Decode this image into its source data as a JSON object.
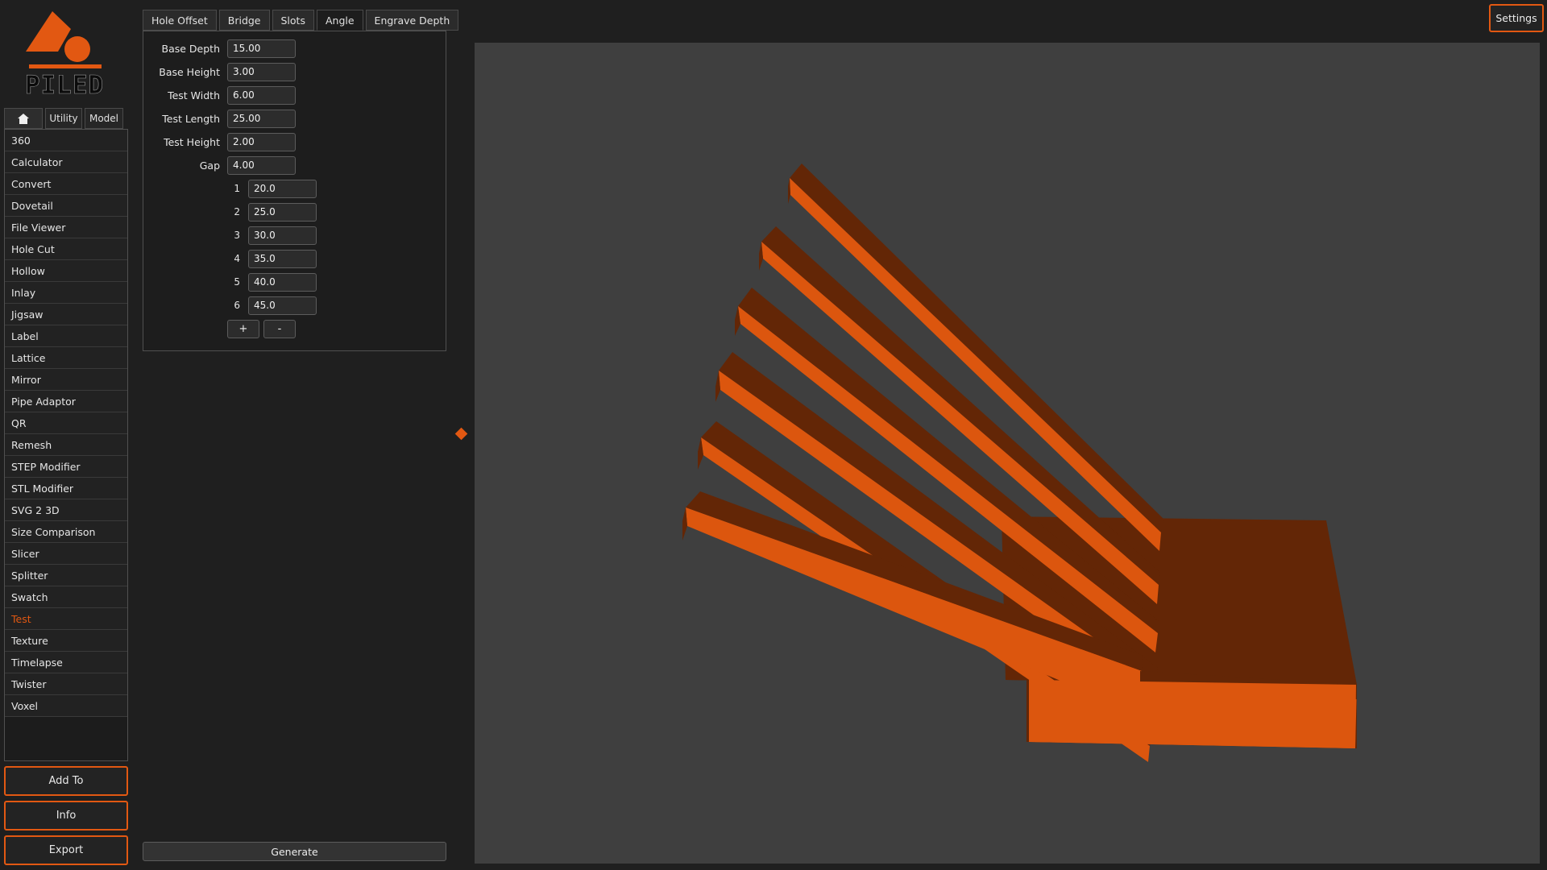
{
  "app": {
    "logo_text": "PILED"
  },
  "nav": {
    "tabs": [
      {
        "label": "",
        "icon": "home-icon"
      },
      {
        "label": "Utility"
      },
      {
        "label": "Model"
      }
    ]
  },
  "tools": [
    "360",
    "Calculator",
    "Convert",
    "Dovetail",
    "File Viewer",
    "Hole Cut",
    "Hollow",
    "Inlay",
    "Jigsaw",
    "Label",
    "Lattice",
    "Mirror",
    "Pipe Adaptor",
    "QR",
    "Remesh",
    "STEP Modifier",
    "STL Modifier",
    "SVG 2 3D",
    "Size Comparison",
    "Slicer",
    "Splitter",
    "Swatch",
    "Test",
    "Texture",
    "Timelapse",
    "Twister",
    "Voxel"
  ],
  "active_tool": "Test",
  "side_buttons": {
    "add_to": "Add To",
    "info": "Info",
    "export": "Export"
  },
  "panel": {
    "tabs": [
      "Hole Offset",
      "Bridge",
      "Slots",
      "Angle",
      "Engrave Depth"
    ],
    "active_tab": "Angle",
    "fields": [
      {
        "label": "Base Depth",
        "value": "15.00"
      },
      {
        "label": "Base Height",
        "value": "3.00"
      },
      {
        "label": "Test Width",
        "value": "6.00"
      },
      {
        "label": "Test Length",
        "value": "25.00"
      },
      {
        "label": "Test Height",
        "value": "2.00"
      },
      {
        "label": "Gap",
        "value": "4.00"
      }
    ],
    "angles": [
      {
        "index": "1",
        "value": "20.0"
      },
      {
        "index": "2",
        "value": "25.0"
      },
      {
        "index": "3",
        "value": "30.0"
      },
      {
        "index": "4",
        "value": "35.0"
      },
      {
        "index": "5",
        "value": "40.0"
      },
      {
        "index": "6",
        "value": "45.0"
      }
    ],
    "add_label": "+",
    "remove_label": "-"
  },
  "generate_label": "Generate",
  "settings_label": "Settings",
  "colors": {
    "accent": "#e25812",
    "model_light": "#dc560e",
    "model_dark": "#632606",
    "viewport_bg": "#3f3f3f"
  }
}
